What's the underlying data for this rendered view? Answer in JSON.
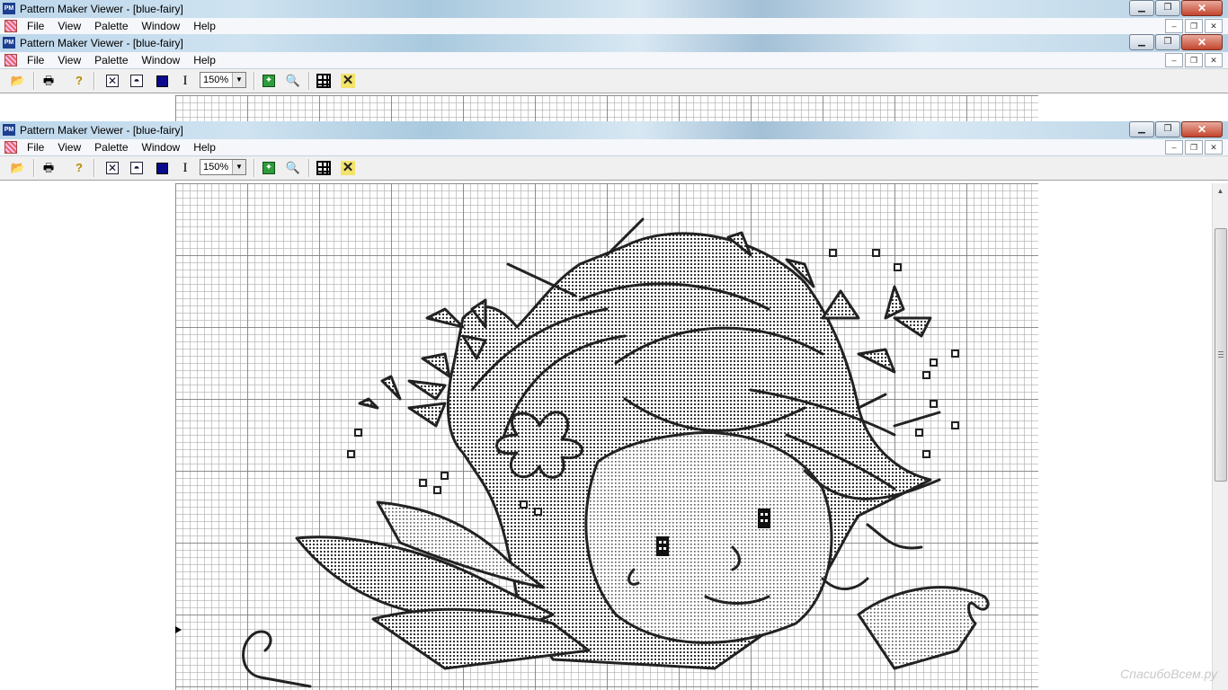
{
  "app_icon_label": "PM",
  "windows": [
    {
      "title": "Pattern Maker Viewer - [blue-fairy]"
    },
    {
      "title": "Pattern Maker Viewer - [blue-fairy]"
    },
    {
      "title": "Pattern Maker Viewer - [blue-fairy]"
    }
  ],
  "menus": [
    "File",
    "View",
    "Palette",
    "Window",
    "Help"
  ],
  "caption_buttons": {
    "minimize": "▁",
    "restore": "❐",
    "close": "✕"
  },
  "mdi_buttons": {
    "minimize": "–",
    "restore": "❐",
    "close": "✕"
  },
  "toolbar": {
    "zoom": "150%",
    "icons": [
      "open-icon",
      "print-icon",
      "help-icon",
      "stitch-cross-icon",
      "backstitch-icon",
      "full-color-icon",
      "text-cursor-icon",
      "fit-to-window-icon",
      "zoom-search-icon",
      "grid-icon",
      "cross-marker-icon"
    ]
  },
  "watermark": "СпасибоВсем.ру"
}
